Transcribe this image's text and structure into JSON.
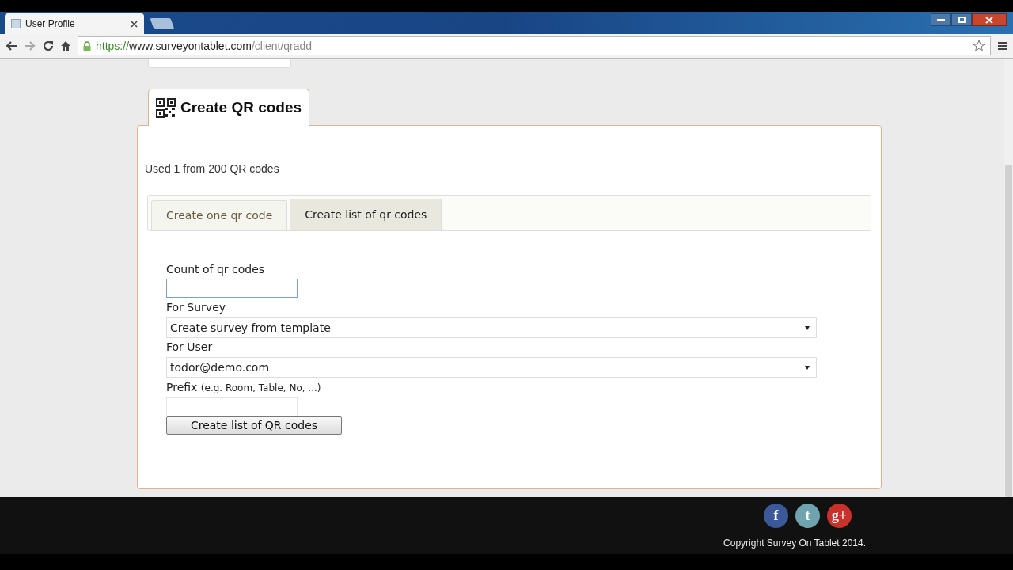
{
  "browser": {
    "tab_title": "User Profile",
    "url_secure": "https://",
    "url_host": "www.surveyontablet.com",
    "url_path": "/client/qradd"
  },
  "panel": {
    "title": "Create QR codes",
    "usage": "Used 1 from 200 QR codes",
    "tabs": [
      {
        "label": "Create one qr code",
        "selected": false
      },
      {
        "label": "Create list of qr codes",
        "selected": true
      }
    ],
    "form": {
      "count_label": "Count of qr codes",
      "survey_label": "For Survey",
      "survey_value": "Create survey from template",
      "user_label": "For User",
      "user_value": "todor@demo.com",
      "prefix_label": "Prefix",
      "prefix_hint": "(e.g. Room, Table, No, ...)",
      "submit": "Create list of QR codes"
    }
  },
  "footer": {
    "social": [
      {
        "glyph": "f",
        "color": "#3b5998"
      },
      {
        "glyph": "t",
        "color": "#6fa3ad"
      },
      {
        "glyph": "g+",
        "color": "#c8322a"
      }
    ],
    "copyright": "Copyright Survey On Tablet 2014."
  }
}
